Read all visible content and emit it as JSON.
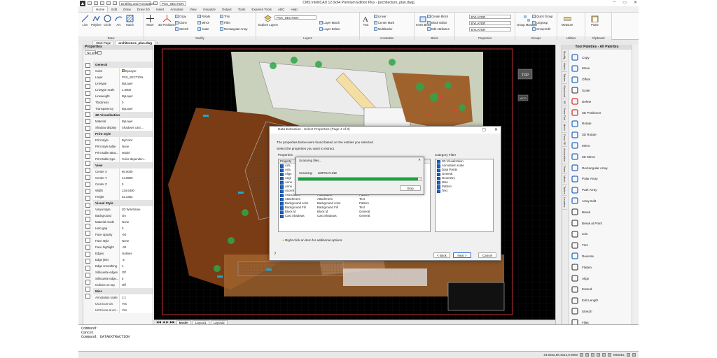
{
  "app": {
    "title": "CMS IntelliCAD 12.0x64 Premium Edition Plus - [architecture_plan.dwg]",
    "workspace": "Drafting and Annotation",
    "layer_combo": "PSX_SECTION"
  },
  "ribbon_tabs": [
    "Home",
    "Edit",
    "Draw",
    "Draw 3D",
    "Insert",
    "Annotate",
    "View",
    "Visualize",
    "Output",
    "Tools",
    "Express Tools",
    "ABC",
    "Help"
  ],
  "ribbon": {
    "draw": {
      "name": "Draw",
      "buttons": [
        "Line",
        "Polyline",
        "Circle",
        "Arc",
        "Hatch"
      ]
    },
    "modify": {
      "name": "Modify",
      "big": [
        "Move",
        "3D Positioner"
      ],
      "small": [
        "Copy",
        "Rotate",
        "Trim",
        "Clone",
        "Mirror",
        "Fillet",
        "Stretch",
        "Scale",
        "Rectangular Array"
      ]
    },
    "layers": {
      "name": "Layers",
      "big": "Explore Layers",
      "combo": "PSX_SECTION",
      "small": [
        "Layer Match",
        "Layer Delete"
      ]
    },
    "annotation": {
      "name": "Annotation",
      "big": "Text",
      "small": [
        "Linear",
        "Center Mark",
        "Multileader"
      ]
    },
    "block": {
      "name": "Block",
      "big": "Insert Block",
      "small": [
        "Create Block",
        "Block Editor",
        "Edit Attributes"
      ]
    },
    "properties": {
      "name": "Properties",
      "combos": [
        "BYLAYER",
        "BYLAYER",
        "BYLAYER"
      ]
    },
    "groups": {
      "name": "Groups",
      "big": "Group Manager",
      "small": [
        "Quick Group",
        "Ungroup",
        "Group Edit"
      ]
    },
    "utilities": {
      "name": "Utilities",
      "big": "Measure"
    },
    "clipboard": {
      "name": "Clipboard",
      "big": "Paste"
    }
  },
  "doc_tabs": [
    "Start Page",
    "architecture_plan.dwg"
  ],
  "properties_panel": {
    "title": "Properties",
    "selection": "No selec",
    "sections": [
      {
        "name": "General",
        "rows": [
          [
            "Color",
            "ByLayer"
          ],
          [
            "Layer",
            "PSX_SECTION"
          ],
          [
            "Linetype",
            "ByLayer"
          ],
          [
            "Linetype scale",
            "1.0000"
          ],
          [
            "Lineweight",
            "ByLayer"
          ],
          [
            "Thickness",
            "0"
          ],
          [
            "Transparency",
            "ByLayer"
          ]
        ]
      },
      {
        "name": "3D Visualization",
        "rows": [
          [
            "Material",
            "ByLayer"
          ],
          [
            "Shadow display",
            "Shadows cast ..."
          ]
        ]
      },
      {
        "name": "Print style",
        "rows": [
          [
            "Print style",
            "ByColor"
          ],
          [
            "Print style table",
            "None"
          ],
          [
            "Print table attac...",
            "Model"
          ],
          [
            "Print table type",
            "Color-dependen..."
          ]
        ]
      },
      {
        "name": "View",
        "rows": [
          [
            "Center X",
            "66.0000"
          ],
          [
            "Center Y",
            "44.5500"
          ],
          [
            "Center Z",
            "0"
          ],
          [
            "Width",
            "134.6400"
          ],
          [
            "Height",
            "32.2352"
          ]
        ]
      },
      {
        "name": "Visual Style",
        "rows": [
          [
            "Visual style",
            "2D Wireframe"
          ],
          [
            "Background",
            "On"
          ],
          [
            "Material mode",
            "None"
          ],
          [
            "Halo gap",
            "0"
          ],
          [
            "Face opacity",
            "-60"
          ],
          [
            "Face style",
            "None"
          ],
          [
            "Face highlight",
            "-30"
          ],
          [
            "Edges",
            "Isolines"
          ],
          [
            "Edge jitter",
            "-2"
          ],
          [
            "Edge smoothing",
            "1"
          ],
          [
            "Silhouette edges",
            "Off"
          ],
          [
            "Silhouette edge...",
            "5"
          ],
          [
            "Isolines on top",
            "Off"
          ]
        ]
      },
      {
        "name": "Misc",
        "rows": [
          [
            "Annotation scale",
            "1:1"
          ],
          [
            "UCS icon On",
            "Yes"
          ],
          [
            "UCS icon at ori...",
            "Yes"
          ]
        ]
      }
    ]
  },
  "canvas": {
    "viewcube_top": "TOP",
    "viewcube_wcs": "WCS"
  },
  "layout_tabs": [
    "Model",
    "Layout1",
    "Layout2"
  ],
  "tool_palettes": {
    "title": "Tool Palettes - All Palettes",
    "side_tabs": [
      "Modify",
      "Hatch",
      "Tables",
      "Structural",
      "3D",
      "Draw Civil",
      "Mech",
      "Draw 3D",
      "Annotation",
      "Draw",
      "Mech",
      "Tables",
      "Leaders"
    ],
    "tools": [
      "Copy",
      "Move",
      "Offset",
      "Scale",
      "Delete",
      "3D Positioner",
      "Rotate",
      "3D Rotate",
      "Mirror",
      "3D Mirror",
      "Rectangular Array",
      "Polar Array",
      "Path Array",
      "Array Edit",
      "Break",
      "Break at Point",
      "Join",
      "Trim",
      "Reverse",
      "Flatten",
      "Align",
      "Extend",
      "Edit Length",
      "Stretch",
      "Fillet"
    ]
  },
  "dialog": {
    "title": "Data Extraction - Select Properties (Page 4 of 8)",
    "intro1": "The properties below were found based on the entities you selected.",
    "intro2": "Select the properties you want to extract.",
    "properties_label": "Properties",
    "filter_label": "Category Filter",
    "columns": [
      "Property",
      "Display Name",
      "Category"
    ],
    "rows": [
      [
        "Accent",
        "Accent",
        "General"
      ],
      [
        "Associative",
        "Associative",
        "Pattern"
      ],
      [
        "Attachment",
        "Attachment",
        "Text"
      ],
      [
        "Background color",
        "Background color",
        "Pattern"
      ],
      [
        "Background Fill",
        "Background Fill",
        "Text"
      ],
      [
        "Block Id",
        "Block Id",
        "General"
      ],
      [
        "Cast Shadows",
        "Cast Shadows",
        "General"
      ]
    ],
    "partial_rows": [
      "Actu",
      "Actu",
      "Align",
      "Angl",
      "Anno",
      "Anno"
    ],
    "filters": [
      "3D Visualization",
      "Annotation scale",
      "Data Points",
      "General",
      "Geometry",
      "Misc",
      "Pattern",
      "Text"
    ],
    "hint": "Right-click an item for additional options.",
    "back": "< Back",
    "next": "Next >",
    "cancel": "Cancel"
  },
  "progress": {
    "title": "Scanning files...",
    "label": "Scanning:",
    "file": "LWPOLYLINE",
    "value": 0.97,
    "stop": "Stop"
  },
  "command": {
    "lines": [
      "Command:",
      "Cancel",
      "Command: DATAEXTRACTION"
    ]
  },
  "status": {
    "coords": "44.6022,56.4014,0.0000",
    "model": "MODEL"
  }
}
